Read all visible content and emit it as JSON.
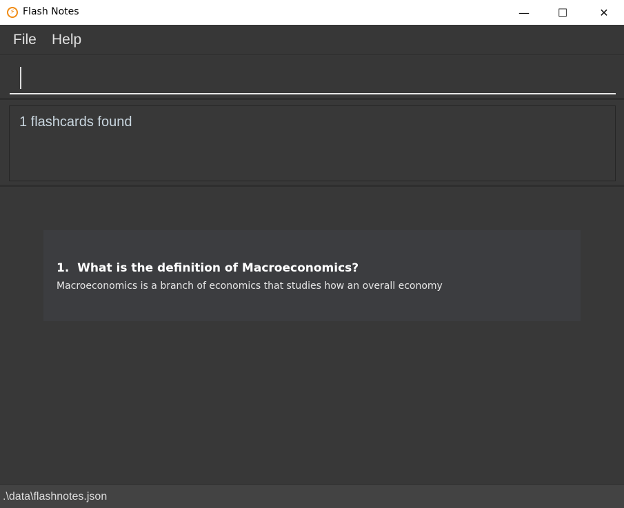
{
  "window": {
    "title": "Flash Notes",
    "minimize": "—",
    "maximize": "☐",
    "close": "✕"
  },
  "menu": {
    "file": "File",
    "help": "Help"
  },
  "command": {
    "value": "",
    "placeholder": ""
  },
  "result": {
    "text": "1 flashcards found"
  },
  "flashcards": [
    {
      "index": "1.",
      "question": "What is the definition of Macroeconomics?",
      "answer": "Macroeconomics is a branch of economics that studies how an overall economy"
    }
  ],
  "status": {
    "path": ".\\data\\flashnotes.json"
  }
}
